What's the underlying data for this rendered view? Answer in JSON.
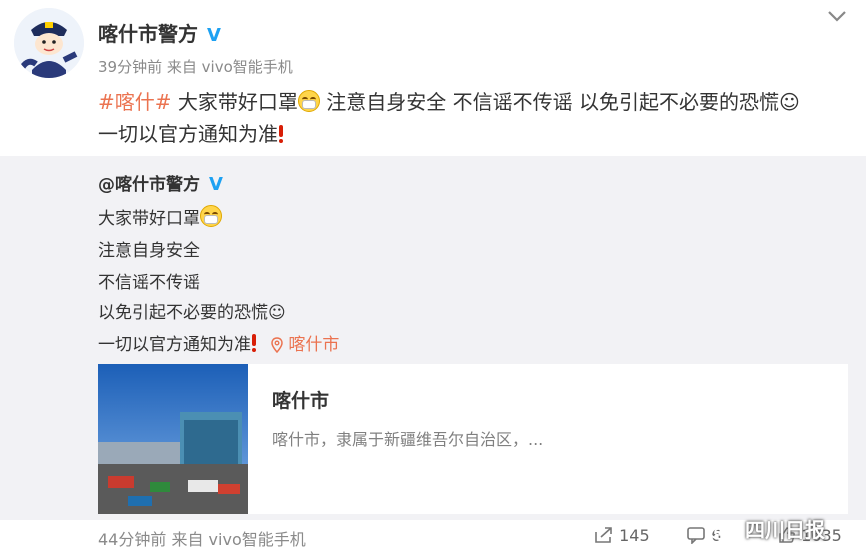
{
  "author": {
    "name": "喀什市警方",
    "verified_mark": "V"
  },
  "meta": {
    "time": "39分钟前",
    "source": "来自 vivo智能手机"
  },
  "post": {
    "hashtag": "#喀什#",
    "segment1": " 大家带好口罩",
    "segment2": " 注意自身安全 不信谣不传谣 以免引起不必要的恐慌☺",
    "segment3": "一切以官方通知为准"
  },
  "quote": {
    "author": "@喀什市警方",
    "verified_mark": "V",
    "lines": [
      "大家带好口罩",
      "注意自身安全",
      "不信谣不传谣",
      "以免引起不必要的恐慌☺",
      "一切以官方通知为准"
    ],
    "location": "喀什市"
  },
  "card": {
    "title": "喀什市",
    "desc": "喀什市，隶属于新疆维吾尔自治区，..."
  },
  "footer": {
    "time": "44分钟前",
    "source": "来自 vivo智能手机",
    "shares": "145",
    "comments": "6",
    "likes": "1635"
  },
  "watermark": "四川日报",
  "colors": {
    "accent": "#eb7350",
    "verified": "#1da1f2"
  }
}
